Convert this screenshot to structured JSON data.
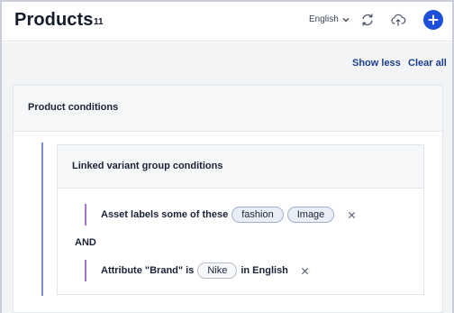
{
  "header": {
    "title": "Products",
    "count": "11",
    "language": "English",
    "icons": {
      "language_caret": "chevron-down-icon",
      "sync": "sync-icon",
      "cloud": "cloud-sync-icon",
      "add": "plus-icon"
    },
    "accent_color": "#1e4fd9"
  },
  "toolbar": {
    "show_less": "Show less",
    "clear_all": "Clear all"
  },
  "product_conditions": {
    "title": "Product conditions",
    "linked_group": {
      "title": "Linked variant group conditions",
      "conditions": [
        {
          "label": "Asset labels some of these",
          "values": [
            "fashion",
            "Image"
          ],
          "suffix": ""
        },
        {
          "label": "Attribute \"Brand\" is",
          "values": [
            "Nike"
          ],
          "suffix": "in English"
        }
      ],
      "operator": "AND"
    }
  }
}
